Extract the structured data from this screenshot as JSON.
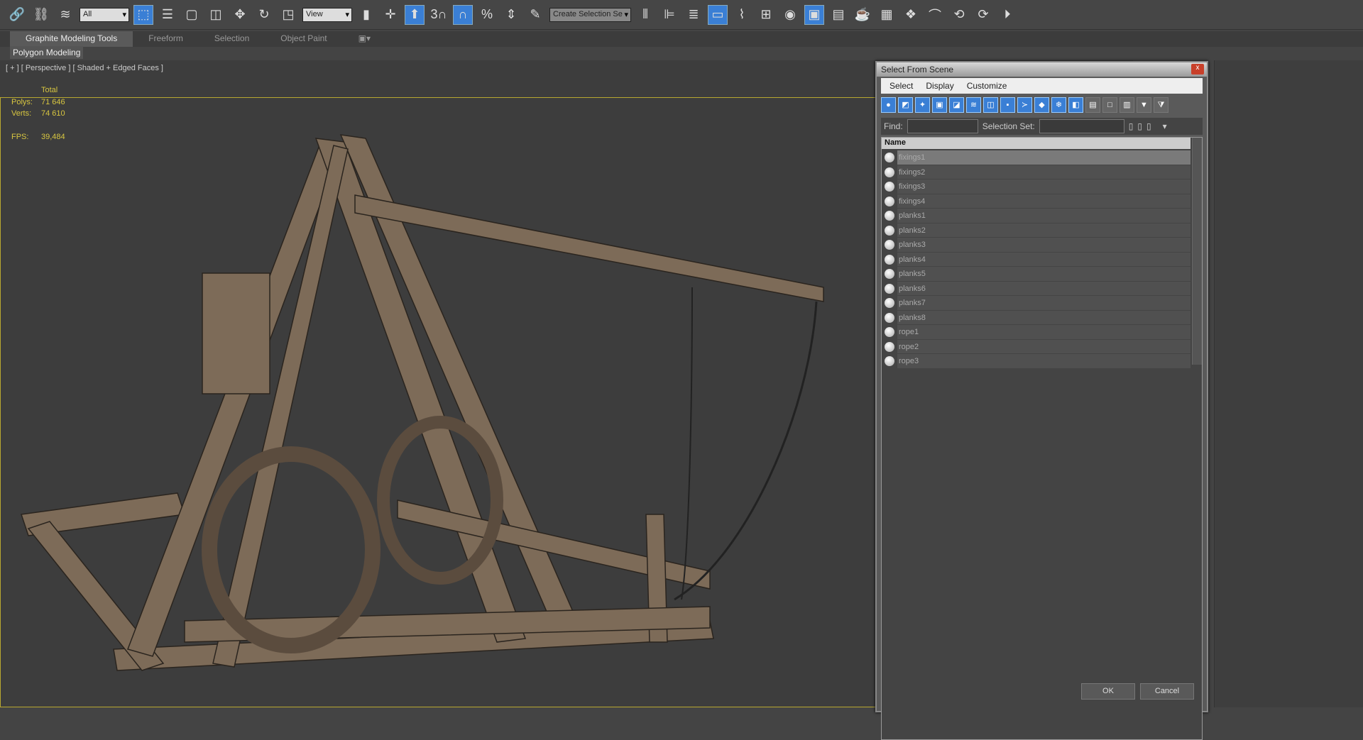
{
  "toolbar": {
    "filter_value": "All",
    "ref_coord": "View",
    "selection_set": "Create Selection Se",
    "snap_label": "3"
  },
  "ribbon": {
    "tabs": [
      "Graphite Modeling Tools",
      "Freeform",
      "Selection",
      "Object Paint"
    ],
    "panel": "Polygon Modeling"
  },
  "viewport": {
    "label": "[ + ] [ Perspective ] [ Shaded + Edged Faces ]",
    "stats_header": "Total",
    "polys_label": "Polys:",
    "polys": "71 646",
    "verts_label": "Verts:",
    "verts": "74 610",
    "fps_label": "FPS:",
    "fps": "39,484"
  },
  "dialog": {
    "title": "Select From Scene",
    "close": "x",
    "menu": [
      "Select",
      "Display",
      "Customize"
    ],
    "find_label": "Find:",
    "find_value": "",
    "selset_label": "Selection Set:",
    "column": "Name",
    "items": [
      "fixings1",
      "fixings2",
      "fixings3",
      "fixings4",
      "planks1",
      "planks2",
      "planks3",
      "planks4",
      "planks5",
      "planks6",
      "planks7",
      "planks8",
      "rope1",
      "rope2",
      "rope3"
    ],
    "ok": "OK",
    "cancel": "Cancel"
  }
}
